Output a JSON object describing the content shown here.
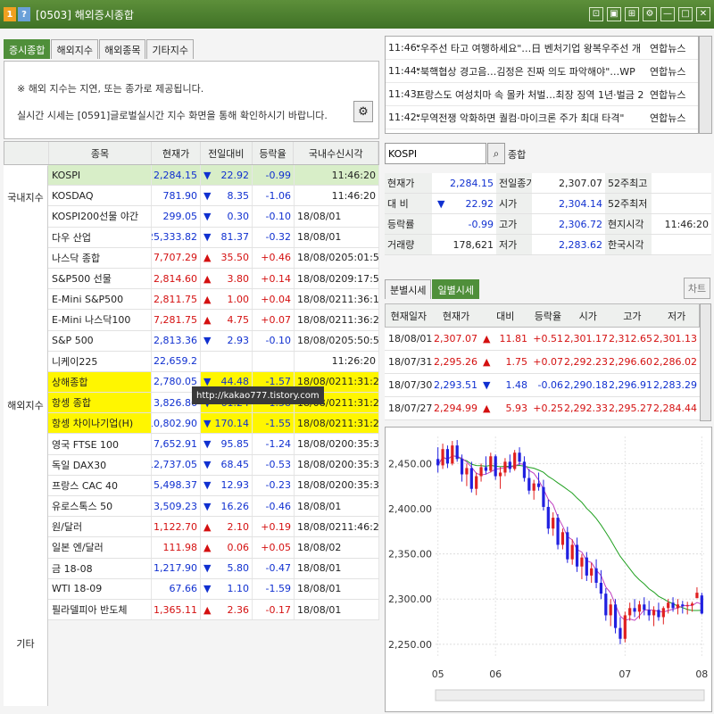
{
  "window": {
    "num1": "1",
    "num2": "?",
    "title": "[0503] 해외증시종합",
    "controls": [
      "⊡",
      "▣",
      "⊞",
      "⚙",
      "—",
      "□",
      "✕"
    ]
  },
  "left_tabs": [
    "증시종합",
    "해외지수",
    "해외종목",
    "기타지수"
  ],
  "notice": {
    "line1": "※ 해외 지수는 지연, 또는 종가로 제공됩니다.",
    "line2": "실시간 시세는 [0591]글로벌실시간 지수  화면을 통해 확인하시기 바랍니다."
  },
  "table": {
    "headers": [
      "종목",
      "현재가",
      "전일대비",
      "등락율",
      "국내수신시각"
    ],
    "groups": [
      "국내지수",
      "해외지수",
      "기타"
    ],
    "rows": [
      {
        "name": "KOSPI",
        "price": "2,284.15",
        "dir": "▼",
        "chg": "22.92",
        "rate": "-0.99",
        "date": "",
        "time": "11:46:20",
        "trend": "down",
        "hl": "green"
      },
      {
        "name": "KOSDAQ",
        "price": "781.90",
        "dir": "▼",
        "chg": "8.35",
        "rate": "-1.06",
        "date": "",
        "time": "11:46:20",
        "trend": "down",
        "hl": ""
      },
      {
        "name": "KOSPI200선물 야간",
        "price": "299.05",
        "dir": "▼",
        "chg": "0.30",
        "rate": "-0.10",
        "date": "18/08/01",
        "time": "",
        "trend": "down",
        "hl": ""
      },
      {
        "name": "다우 산업",
        "price": "25,333.82",
        "dir": "▼",
        "chg": "81.37",
        "rate": "-0.32",
        "date": "18/08/01",
        "time": "",
        "trend": "down",
        "hl": ""
      },
      {
        "name": "나스닥 종합",
        "price": "7,707.29",
        "dir": "▲",
        "chg": "35.50",
        "rate": "+0.46",
        "date": "18/08/02",
        "time": "05:01:59",
        "trend": "up",
        "hl": ""
      },
      {
        "name": "S&P500 선물",
        "price": "2,814.60",
        "dir": "▲",
        "chg": "3.80",
        "rate": "+0.14",
        "date": "18/08/02",
        "time": "09:17:53",
        "trend": "up",
        "hl": ""
      },
      {
        "name": "E-Mini S&P500",
        "price": "2,811.75",
        "dir": "▲",
        "chg": "1.00",
        "rate": "+0.04",
        "date": "18/08/02",
        "time": "11:36:16",
        "trend": "up",
        "hl": ""
      },
      {
        "name": "E-Mini 나스닥100",
        "price": "7,281.75",
        "dir": "▲",
        "chg": "4.75",
        "rate": "+0.07",
        "date": "18/08/02",
        "time": "11:36:21",
        "trend": "up",
        "hl": ""
      },
      {
        "name": "S&P 500",
        "price": "2,813.36",
        "dir": "▼",
        "chg": "2.93",
        "rate": "-0.10",
        "date": "18/08/02",
        "time": "05:50:56",
        "trend": "down",
        "hl": ""
      },
      {
        "name": "니케이225",
        "price": "22,659.2",
        "dir": "",
        "chg": "",
        "rate": "",
        "date": "",
        "time": "11:26:20",
        "trend": "down",
        "hl": ""
      },
      {
        "name": "상해종합",
        "price": "2,780.05",
        "dir": "▼",
        "chg": "44.48",
        "rate": "-1.57",
        "date": "18/08/02",
        "time": "11:31:23",
        "trend": "down",
        "hl": "yellow"
      },
      {
        "name": "항셍 종합",
        "price": "3,826.86",
        "dir": "▼",
        "chg": "61.24",
        "rate": "-1.58",
        "date": "18/08/02",
        "time": "11:31:24",
        "trend": "down",
        "hl": "yellow"
      },
      {
        "name": "항셍 차이나기업(H)",
        "price": "10,802.90",
        "dir": "▼",
        "chg": "170.14",
        "rate": "-1.55",
        "date": "18/08/02",
        "time": "11:31:24",
        "trend": "down",
        "hl": "yellow"
      },
      {
        "name": "영국 FTSE 100",
        "price": "7,652.91",
        "dir": "▼",
        "chg": "95.85",
        "rate": "-1.24",
        "date": "18/08/02",
        "time": "00:35:30",
        "trend": "down",
        "hl": ""
      },
      {
        "name": "독일 DAX30",
        "price": "12,737.05",
        "dir": "▼",
        "chg": "68.45",
        "rate": "-0.53",
        "date": "18/08/02",
        "time": "00:35:30",
        "trend": "down",
        "hl": ""
      },
      {
        "name": "프랑스 CAC 40",
        "price": "5,498.37",
        "dir": "▼",
        "chg": "12.93",
        "rate": "-0.23",
        "date": "18/08/02",
        "time": "00:35:30",
        "trend": "down",
        "hl": ""
      },
      {
        "name": "유로스톡스 50",
        "price": "3,509.23",
        "dir": "▼",
        "chg": "16.26",
        "rate": "-0.46",
        "date": "18/08/01",
        "time": "",
        "trend": "down",
        "hl": ""
      },
      {
        "name": "원/달러",
        "price": "1,122.70",
        "dir": "▲",
        "chg": "2.10",
        "rate": "+0.19",
        "date": "18/08/02",
        "time": "11:46:20",
        "trend": "up",
        "hl": ""
      },
      {
        "name": "일본 엔/달러",
        "price": "111.98",
        "dir": "▲",
        "chg": "0.06",
        "rate": "+0.05",
        "date": "18/08/02",
        "time": "",
        "trend": "up",
        "hl": ""
      },
      {
        "name": "금 18-08",
        "price": "1,217.90",
        "dir": "▼",
        "chg": "5.80",
        "rate": "-0.47",
        "date": "18/08/01",
        "time": "",
        "trend": "down",
        "hl": ""
      },
      {
        "name": "WTI 18-09",
        "price": "67.66",
        "dir": "▼",
        "chg": "1.10",
        "rate": "-1.59",
        "date": "18/08/01",
        "time": "",
        "trend": "down",
        "hl": ""
      },
      {
        "name": "필라델피아 반도체",
        "price": "1,365.11",
        "dir": "▲",
        "chg": "2.36",
        "rate": "-0.17",
        "date": "18/08/01",
        "time": "",
        "trend": "up",
        "hl": ""
      }
    ]
  },
  "watermark": "http://kakao777.tistory.com",
  "news": [
    {
      "time": "11:46:",
      "title": "\"우주선 타고 여행하세요\"…日 벤처기업 왕복우주선 개",
      "source": "연합뉴스"
    },
    {
      "time": "11:44:",
      "title": "\"북핵협상 경고음…김정은 진짜 의도 파악해야\"…WP",
      "source": "연합뉴스"
    },
    {
      "time": "11:43:",
      "title": "프랑스도 여성치마 속 몰카 처벌…최장 징역 1년·벌금 2",
      "source": "연합뉴스"
    },
    {
      "time": "11:42:",
      "title": "\"무역전쟁 악화하면 퀄컴·마이크론 주가 최대 타격\"",
      "source": "연합뉴스"
    }
  ],
  "search": {
    "value": "KOSPI",
    "label": "종합"
  },
  "quote": {
    "rows": [
      {
        "l1": "현재가",
        "v1": "2,284.15",
        "l2": "전일종가",
        "v2": "2,307.07",
        "l3": "52주최고",
        "v3": ""
      },
      {
        "l1": "대 비",
        "v1": "22.92",
        "l2": "시가",
        "v2": "2,304.14",
        "l3": "52주최저",
        "v3": ""
      },
      {
        "l1": "등락률",
        "v1": "-0.99",
        "l2": "고가",
        "v2": "2,306.72",
        "l3": "현지시각",
        "v3": "11:46:20"
      },
      {
        "l1": "거래량",
        "v1": "178,621",
        "l2": "저가",
        "v2": "2,283.62",
        "l3": "한국시각",
        "v3": ""
      }
    ],
    "dir": "▼"
  },
  "right_tabs": [
    "분별시세",
    "일별시세"
  ],
  "chart_button": "차트",
  "daily": {
    "headers": [
      "현재일자",
      "현재가",
      "대비",
      "등락율",
      "시가",
      "고가",
      "저가"
    ],
    "rows": [
      {
        "date": "18/08/01",
        "price": "2,307.07",
        "dir": "▲",
        "chg": "11.81",
        "rate": "+0.51",
        "open": "2,301.17",
        "high": "2,312.65",
        "low": "2,301.13",
        "trend": "up"
      },
      {
        "date": "18/07/31",
        "price": "2,295.26",
        "dir": "▲",
        "chg": "1.75",
        "rate": "+0.07",
        "open": "2,292.23",
        "high": "2,296.60",
        "low": "2,286.02",
        "trend": "up"
      },
      {
        "date": "18/07/30",
        "price": "2,293.51",
        "dir": "▼",
        "chg": "1.48",
        "rate": "-0.06",
        "open": "2,290.18",
        "high": "2,296.91",
        "low": "2,283.29",
        "trend": "down"
      },
      {
        "date": "18/07/27",
        "price": "2,294.99",
        "dir": "▲",
        "chg": "5.93",
        "rate": "+0.25",
        "open": "2,292.33",
        "high": "2,295.27",
        "low": "2,284.44",
        "trend": "up"
      }
    ]
  },
  "chart_data": {
    "type": "candlestick",
    "y_ticks": [
      "2,450.00",
      "2,400.00",
      "2,350.00",
      "2,300.00",
      "2,250.00"
    ],
    "y_tick_values": [
      2450,
      2400,
      2350,
      2300,
      2250
    ],
    "x_ticks": [
      "05",
      "06",
      "07",
      "08"
    ],
    "ylim": [
      2235,
      2480
    ],
    "grid": true,
    "colors": {
      "up": "#e02020",
      "down": "#2020e0",
      "ma5": "#c040c0",
      "ma20": "#20a020"
    },
    "ohlc": [
      [
        2455,
        2468,
        2440,
        2448
      ],
      [
        2448,
        2472,
        2444,
        2466
      ],
      [
        2466,
        2470,
        2445,
        2450
      ],
      [
        2450,
        2475,
        2448,
        2470
      ],
      [
        2470,
        2476,
        2452,
        2455
      ],
      [
        2455,
        2460,
        2430,
        2438
      ],
      [
        2438,
        2450,
        2425,
        2445
      ],
      [
        2445,
        2452,
        2418,
        2422
      ],
      [
        2422,
        2440,
        2415,
        2436
      ],
      [
        2436,
        2450,
        2430,
        2446
      ],
      [
        2446,
        2458,
        2438,
        2442
      ],
      [
        2442,
        2462,
        2440,
        2458
      ],
      [
        2458,
        2460,
        2432,
        2436
      ],
      [
        2436,
        2446,
        2422,
        2440
      ],
      [
        2440,
        2456,
        2436,
        2452
      ],
      [
        2452,
        2460,
        2440,
        2444
      ],
      [
        2444,
        2465,
        2442,
        2462
      ],
      [
        2462,
        2468,
        2448,
        2452
      ],
      [
        2452,
        2458,
        2430,
        2434
      ],
      [
        2434,
        2444,
        2416,
        2420
      ],
      [
        2420,
        2432,
        2410,
        2428
      ],
      [
        2428,
        2440,
        2420,
        2424
      ],
      [
        2424,
        2432,
        2398,
        2402
      ],
      [
        2402,
        2410,
        2372,
        2378
      ],
      [
        2378,
        2396,
        2370,
        2390
      ],
      [
        2390,
        2394,
        2355,
        2360
      ],
      [
        2360,
        2378,
        2355,
        2374
      ],
      [
        2374,
        2380,
        2340,
        2344
      ],
      [
        2344,
        2366,
        2338,
        2360
      ],
      [
        2360,
        2368,
        2330,
        2336
      ],
      [
        2336,
        2350,
        2322,
        2346
      ],
      [
        2346,
        2352,
        2320,
        2326
      ],
      [
        2326,
        2340,
        2318,
        2334
      ],
      [
        2334,
        2344,
        2312,
        2318
      ],
      [
        2318,
        2332,
        2300,
        2306
      ],
      [
        2306,
        2312,
        2276,
        2282
      ],
      [
        2282,
        2300,
        2270,
        2294
      ],
      [
        2294,
        2300,
        2262,
        2268
      ],
      [
        2268,
        2280,
        2250,
        2256
      ],
      [
        2256,
        2286,
        2252,
        2282
      ],
      [
        2282,
        2296,
        2276,
        2290
      ],
      [
        2290,
        2300,
        2280,
        2286
      ],
      [
        2286,
        2298,
        2278,
        2294
      ],
      [
        2294,
        2302,
        2282,
        2288
      ],
      [
        2288,
        2298,
        2276,
        2282
      ],
      [
        2282,
        2292,
        2270,
        2288
      ],
      [
        2288,
        2296,
        2276,
        2280
      ],
      [
        2280,
        2292,
        2272,
        2290
      ],
      [
        2290,
        2300,
        2284,
        2296
      ],
      [
        2296,
        2302,
        2286,
        2290
      ],
      [
        2290,
        2300,
        2283,
        2294
      ],
      [
        2294,
        2298,
        2284,
        2292
      ],
      [
        2292,
        2297,
        2283,
        2293
      ],
      [
        2293,
        2297,
        2286,
        2295
      ],
      [
        2301,
        2313,
        2301,
        2307
      ],
      [
        2304,
        2307,
        2283,
        2284
      ]
    ]
  }
}
